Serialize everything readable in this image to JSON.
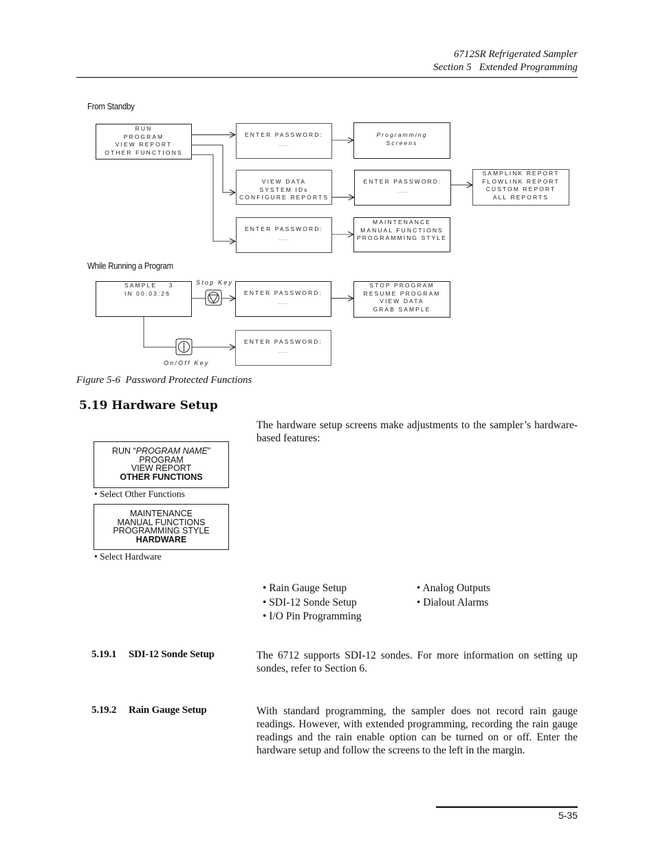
{
  "header": {
    "title_line1": "6712SR Refrigerated Sampler",
    "title_line2": "Section 5   Extended Programming"
  },
  "figure": {
    "caption": "Figure 5-6  Password Protected Functions",
    "from_standby_label": "From Standby",
    "while_running_label": "While Running a Program",
    "standby_menu": [
      "RUN",
      "PROGRAM",
      "VIEW REPORT",
      "OTHER FUNCTIONS"
    ],
    "password_prompt": "ENTER PASSWORD:",
    "password_mask": "----",
    "programming_screens": [
      "Programming",
      "Screens"
    ],
    "view_report_menu": [
      "VIEW DATA",
      "SYSTEM IDs",
      "CONFIGURE REPORTS"
    ],
    "report_menu": [
      "SAMPLINK REPORT",
      "FLOWLINK REPORT",
      "CUSTOM REPORT",
      "ALL REPORTS"
    ],
    "other_functions_menu": [
      "MAINTENANCE",
      "MANUAL FUNCTIONS",
      "PROGRAMMING STYLE"
    ],
    "running_status": [
      "SAMPLE    3",
      "IN 00:03:26"
    ],
    "stop_key_label": "Stop Key",
    "onoff_key_label": "On/Off Key",
    "stop_menu": [
      "STOP PROGRAM",
      "RESUME PROGRAM",
      "VIEW DATA",
      "GRAB SAMPLE"
    ],
    "icons": {
      "stop_key": "stop-key-icon",
      "onoff_key": "power-key-icon"
    }
  },
  "section": {
    "heading": "5.19 Hardware Setup",
    "intro": "The hardware setup screens make adjustments to the sampler’s hardware-based features:",
    "screen1": {
      "run_prefix": "RUN “",
      "program_name": "PROGRAM NAME",
      "run_suffix": "”",
      "lines": [
        "PROGRAM",
        "VIEW REPORT"
      ],
      "selected": "OTHER FUNCTIONS"
    },
    "note1": "• Select Other Functions",
    "screen2": {
      "lines": [
        "MAINTENANCE",
        "MANUAL FUNCTIONS",
        "PROGRAMMING STYLE"
      ],
      "selected": "HARDWARE"
    },
    "note2": "• Select Hardware",
    "features_col1": [
      "• Rain Gauge Setup",
      "• SDI-12 Sonde Setup",
      "• I/O Pin Programming"
    ],
    "features_col2": [
      "• Analog Outputs",
      "• Dialout Alarms"
    ],
    "sub1": {
      "number": "5.19.1",
      "title": "SDI-12 Sonde Setup",
      "text": "The 6712 supports SDI-12 sondes. For more information on setting up sondes, refer to Section 6."
    },
    "sub2": {
      "number": "5.19.2",
      "title": "Rain Gauge Setup",
      "text": "With standard programming, the sampler does not record rain gauge readings. However, with extended programming, recording the rain gauge readings and the rain enable option can be turned on or off. Enter the hardware setup and follow the screens to the left in the margin."
    }
  },
  "footer": {
    "page_number": "5-35"
  }
}
